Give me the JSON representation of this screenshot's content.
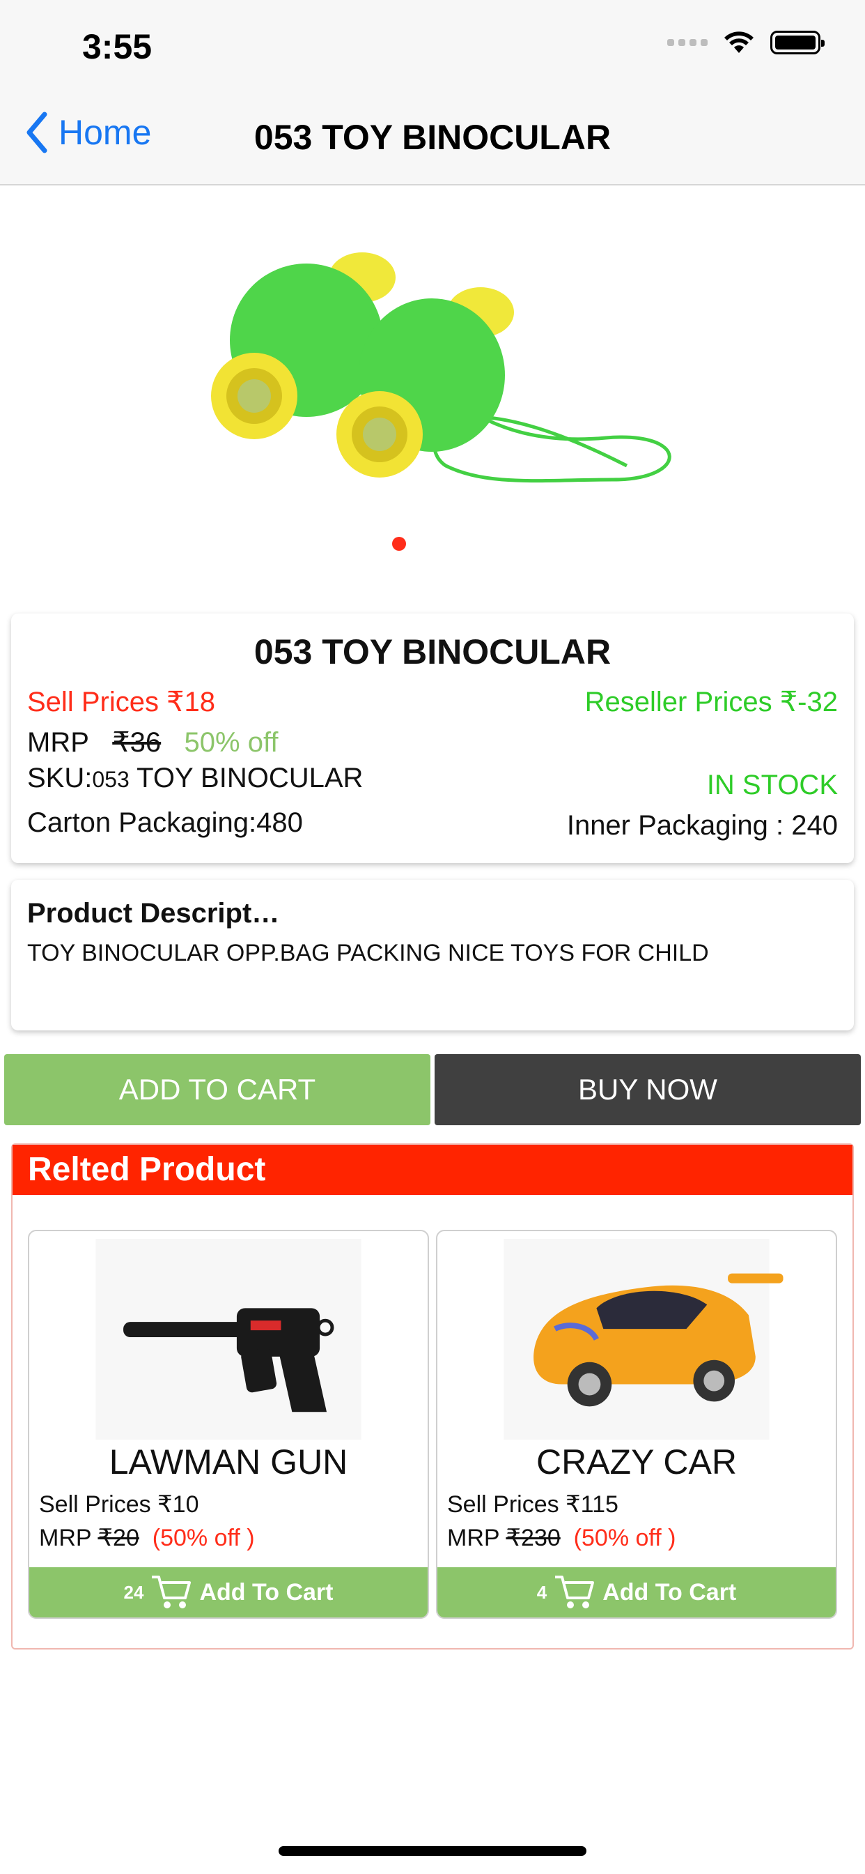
{
  "status_bar": {
    "time": "3:55"
  },
  "nav": {
    "back_label": "Home",
    "title": "053 TOY BINOCULAR"
  },
  "product": {
    "title": "053 TOY BINOCULAR",
    "sell_price": "Sell Prices ₹18",
    "reseller_price": "Reseller Prices ₹-32",
    "mrp_label": "MRP",
    "mrp_value": "₹36",
    "discount": "50% off",
    "sku_label": "SKU:",
    "sku_code": "053",
    "sku_name": " TOY BINOCULAR",
    "stock": "IN STOCK",
    "carton": "Carton Packaging:480",
    "inner": "Inner Packaging : 240",
    "carousel": {
      "current": 1,
      "total": 1
    }
  },
  "description": {
    "heading": "Product Descript…",
    "text": "TOY BINOCULAR OPP.BAG PACKING NICE TOYS FOR CHILD"
  },
  "actions": {
    "add_to_cart": "ADD TO CART",
    "buy_now": "BUY NOW"
  },
  "related": {
    "heading": "Relted Product",
    "items": [
      {
        "name": "LAWMAN GUN",
        "sell": "Sell Prices ₹10",
        "mrp_label": "MRP",
        "mrp_value": "₹20",
        "off": "(50% off )",
        "count": "24",
        "cart_label": "Add To Cart"
      },
      {
        "name": "CRAZY CAR",
        "sell": "Sell Prices ₹115",
        "mrp_label": "MRP",
        "mrp_value": "₹230",
        "off": "(50% off )",
        "count": "4",
        "cart_label": "Add To Cart"
      }
    ]
  },
  "colors": {
    "accent_blue": "#1877f2",
    "sell_red": "#ff2d1a",
    "reseller_green": "#2ecc28",
    "cart_green": "#8cc56a",
    "buy_dark": "#404040",
    "related_red": "#ff2400"
  }
}
